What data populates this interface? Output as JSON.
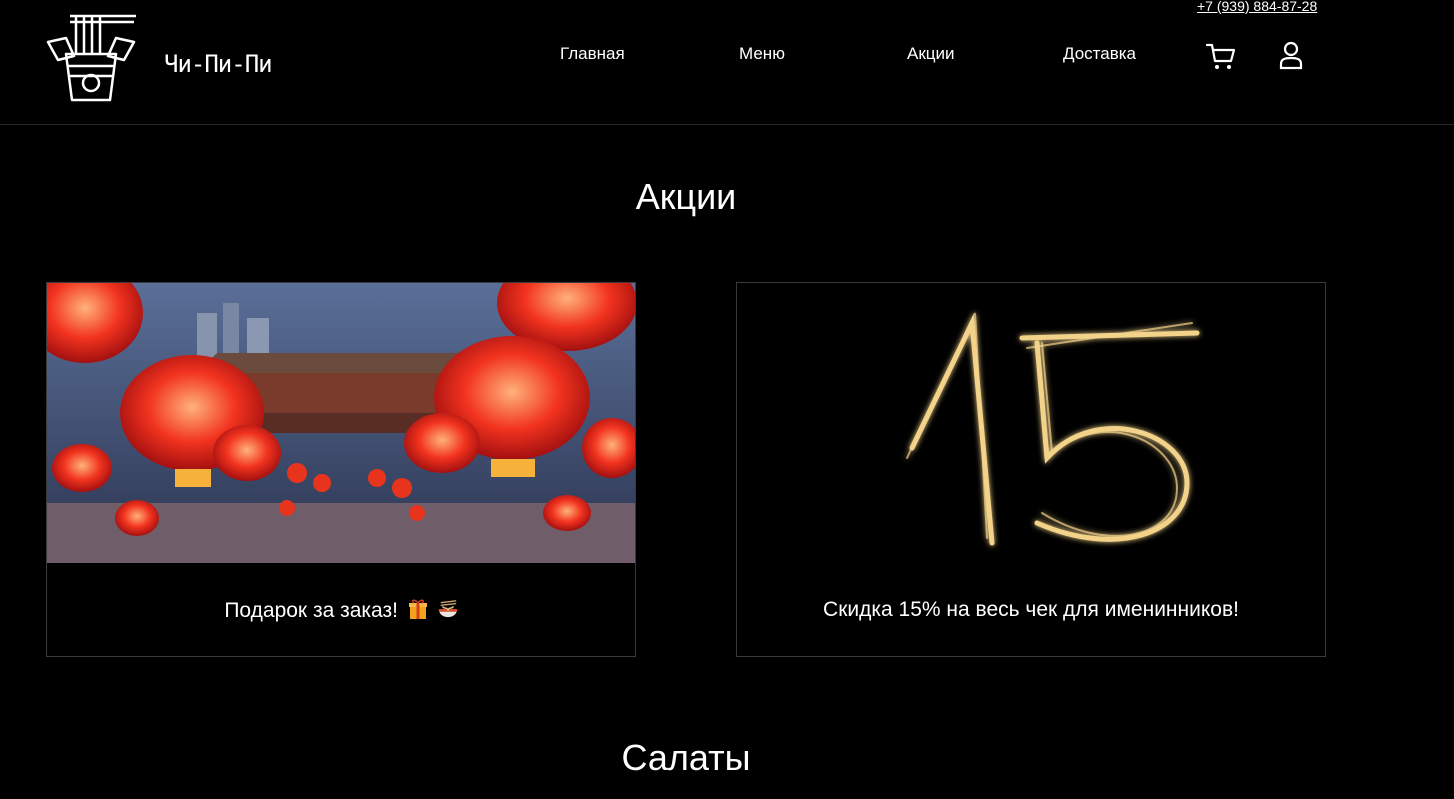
{
  "header": {
    "phone": "+7 (939) 884-87-28",
    "brand": "Чи-Пи-Пи",
    "nav": [
      "Главная",
      "Меню",
      "Акции",
      "Доставка"
    ],
    "icons": [
      "cart-icon",
      "user-icon"
    ]
  },
  "promotions": {
    "title": "Акции",
    "cards": [
      {
        "text": "Подарок за заказ!",
        "emoji": [
          "gift-icon",
          "noodle-bowl-icon"
        ]
      },
      {
        "text": "Скидка 15% на весь чек для именинников!",
        "image_number": "15"
      }
    ]
  },
  "salads": {
    "title": "Салаты"
  },
  "colors": {
    "background": "#000000",
    "text": "#ffffff",
    "lantern": "#e8341c",
    "sparkler": "#f3d38a"
  }
}
